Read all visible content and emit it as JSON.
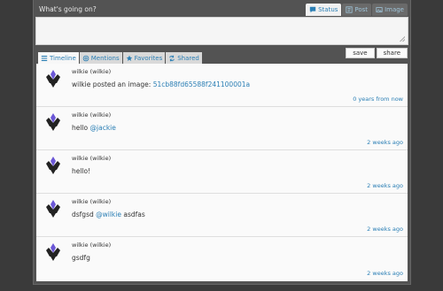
{
  "header": {
    "title": "What's going on?",
    "post_tabs": [
      {
        "label": "Status",
        "icon": "comment-icon",
        "active": true
      },
      {
        "label": "Post",
        "icon": "document-icon",
        "active": false
      },
      {
        "label": "Image",
        "icon": "image-icon",
        "active": false
      }
    ]
  },
  "compose": {
    "placeholder": "",
    "save_label": "save",
    "share_label": "share"
  },
  "feed_tabs": [
    {
      "label": "Timeline",
      "icon": "list-icon",
      "active": true
    },
    {
      "label": "Mentions",
      "icon": "at-icon",
      "active": false
    },
    {
      "label": "Favorites",
      "icon": "star-icon",
      "active": false
    },
    {
      "label": "Shared",
      "icon": "share-icon",
      "active": false
    }
  ],
  "feed": [
    {
      "author": "wilkie (wilkie)",
      "text": "wilkie posted an image: ",
      "link": "51cb88fd65588f241100001a",
      "time": "0 years from now"
    },
    {
      "author": "wilkie (wilkie)",
      "text": "hello ",
      "link": "@jackie",
      "time": "2 weeks ago"
    },
    {
      "author": "wilkie (wilkie)",
      "text": "hello!",
      "link": "",
      "time": "2 weeks ago"
    },
    {
      "author": "wilkie (wilkie)",
      "text": "dsfgsd ",
      "link": "@wilkie",
      "suffix": " asdfas",
      "time": "2 weeks ago"
    },
    {
      "author": "wilkie (wilkie)",
      "text": "gsdfg",
      "link": "",
      "time": "2 weeks ago"
    }
  ],
  "colors": {
    "background": "#3a3a3a",
    "panel": "#535353",
    "accent": "#2b7fb5",
    "avatar": "#6b57d6"
  }
}
